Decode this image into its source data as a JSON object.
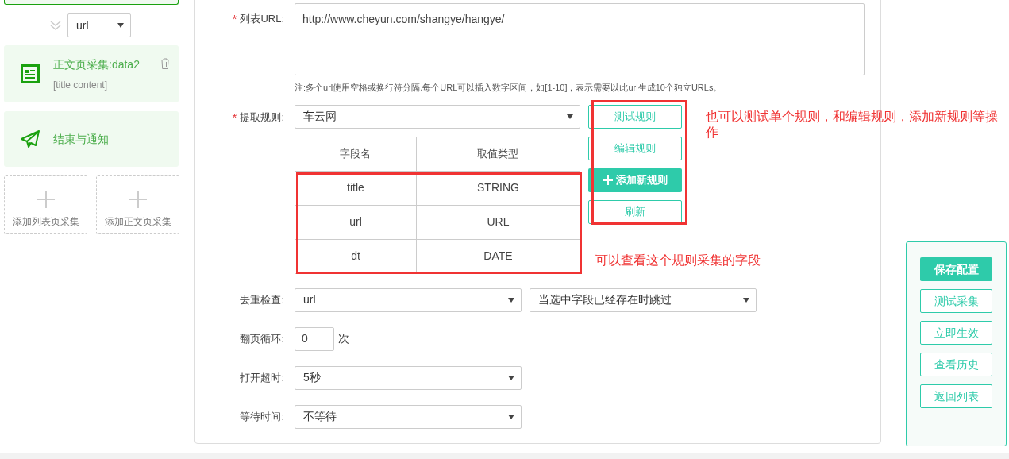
{
  "sidebar": {
    "flow_select": "url",
    "steps": [
      {
        "kind": "content",
        "title": "正文页采集:data2",
        "fields": "[title content]"
      },
      {
        "kind": "notify",
        "title": "结束与通知"
      }
    ],
    "add_tiles": [
      "添加列表页采集",
      "添加正文页采集"
    ]
  },
  "form": {
    "url": {
      "label": "列表URL:",
      "required_mark": "*",
      "value": "http://www.cheyun.com/shangye/hangye/",
      "note": "注:多个url使用空格或换行符分隔.每个URL可以插入数字区间，如[1-10]，表示需要以此url生成10个独立URLs。"
    },
    "rule": {
      "label": "提取规则:",
      "required_mark": "*",
      "value": "车云网",
      "table": {
        "columns": [
          "字段名",
          "取值类型"
        ],
        "rows": [
          [
            "title",
            "STRING"
          ],
          [
            "url",
            "URL"
          ],
          [
            "dt",
            "DATE"
          ]
        ]
      },
      "buttons": [
        {
          "label": "测试规则",
          "kind": "outline"
        },
        {
          "label": "编辑规则",
          "kind": "outline"
        },
        {
          "label": "添加新规则",
          "kind": "add"
        },
        {
          "label": "刷新",
          "kind": "outline"
        }
      ]
    },
    "dedup": {
      "label": "去重检查:",
      "field": "url",
      "mode": "当选中字段已经存在时跳过"
    },
    "page_loop": {
      "label": "翻页循环:",
      "value": "0",
      "unit": "次"
    },
    "timeout": {
      "label": "打开超时:",
      "value": "5秒"
    },
    "wait": {
      "label": "等待时间:",
      "value": "不等待"
    }
  },
  "actions": [
    {
      "label": "保存配置",
      "primary": true
    },
    {
      "label": "测试采集",
      "primary": false
    },
    {
      "label": "立即生效",
      "primary": false
    },
    {
      "label": "查看历史",
      "primary": false
    },
    {
      "label": "返回列表",
      "primary": false
    }
  ],
  "annotations": [
    {
      "kind": "buttons",
      "text": "也可以测试单个规则，和编辑规则，添加新规则等操作"
    },
    {
      "kind": "table",
      "text": "可以查看这个规则采集的字段"
    }
  ]
}
